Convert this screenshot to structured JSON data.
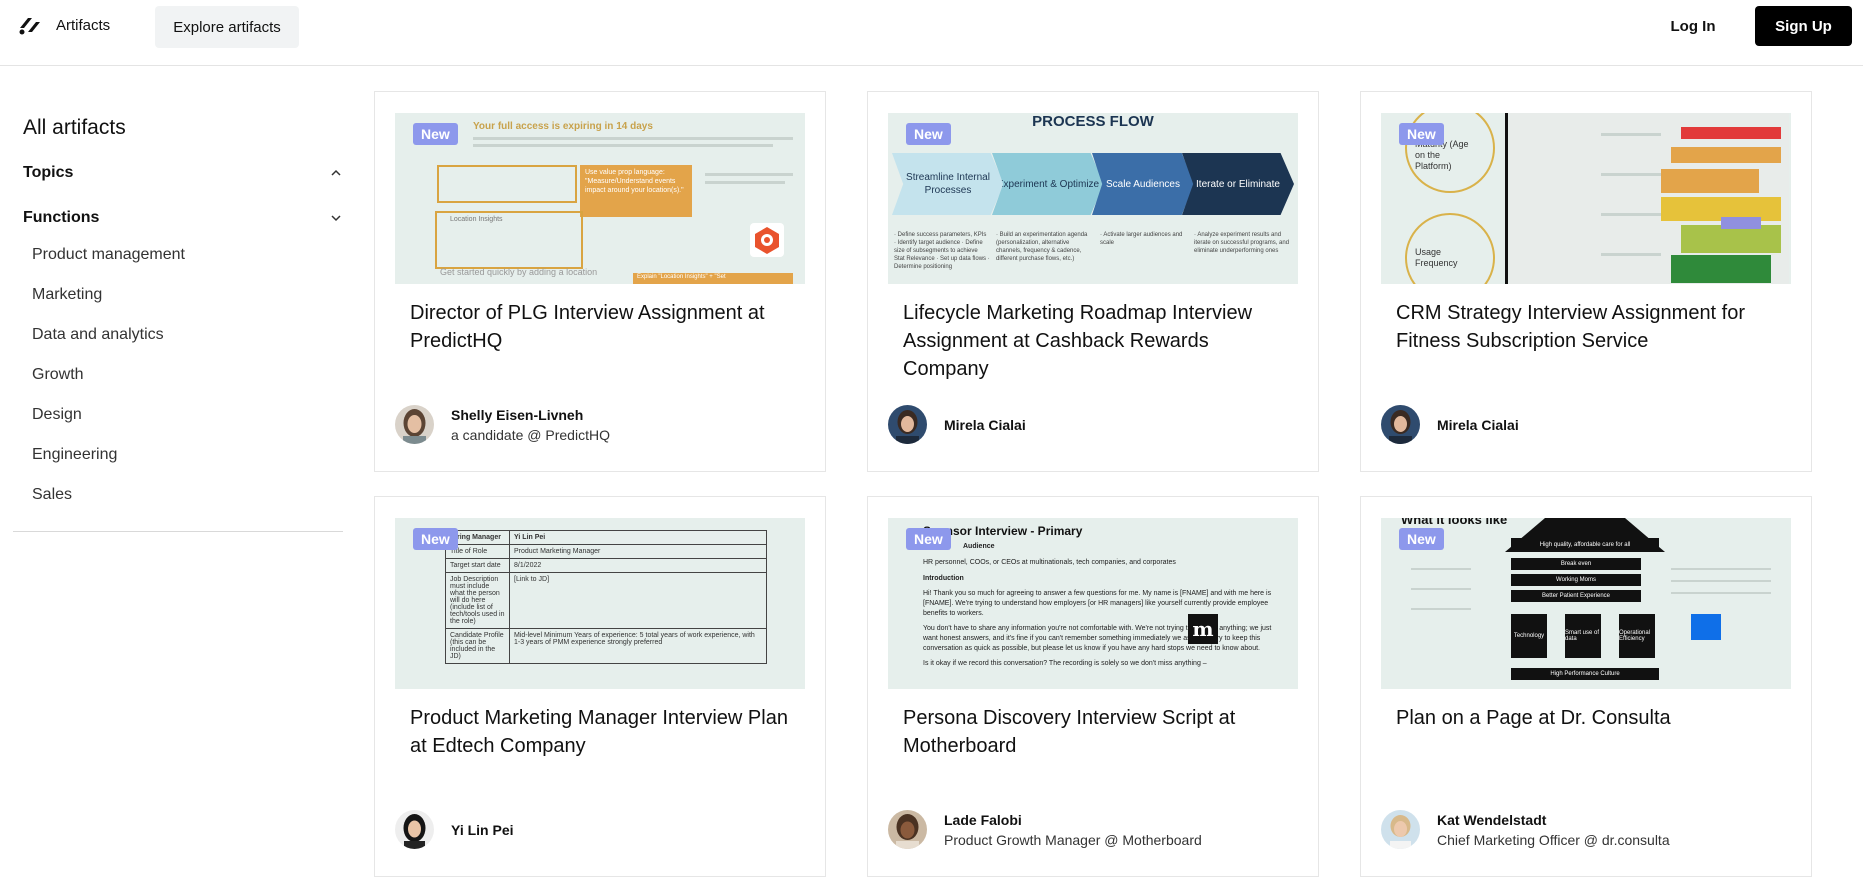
{
  "header": {
    "brand": "Artifacts",
    "explore": "Explore artifacts",
    "login": "Log In",
    "signup": "Sign Up"
  },
  "sidebar": {
    "title": "All artifacts",
    "topics": "Topics",
    "functions": "Functions",
    "function_items": [
      "Product management",
      "Marketing",
      "Data and analytics",
      "Growth",
      "Design",
      "Engineering",
      "Sales"
    ]
  },
  "cards": [
    {
      "badge": "New",
      "title": "Director of PLG Interview Assignment at PredictHQ",
      "author": "Shelly Eisen-Livneh",
      "role": "a candidate @ PredictHQ",
      "thumb": {
        "text1": "Your full access is expiring in 14 days",
        "text2": "Use value prop language: \"Measure/Understand events impact around your location(s).\"",
        "text3": "Location Insights",
        "text4": "Get started quickly by adding a location",
        "text5": "Explain \"Location Insights\" + \"Set"
      }
    },
    {
      "badge": "New",
      "title": "Lifecycle Marketing Roadmap Interview Assignment at Cashback Rewards Company",
      "author": "Mirela Cialai",
      "role": "",
      "thumb": {
        "heading": "PROCESS FLOW",
        "steps": [
          "Streamline Internal Processes",
          "Experiment & Optimize",
          "Scale Audiences",
          "Iterate or Eliminate"
        ],
        "cols": [
          "· Define success parameters, KPIs · Identify target audience · Define size of subsegments to achieve Stat Relevance · Set up data flows · Determine positioning",
          "· Build an experimentation agenda (personalization, alternative channels, frequency & cadence, different purchase flows, etc.)",
          "· Activate larger audiences and scale",
          "· Analyze experiment results and iterate on successful programs, and eliminate underperforming ones"
        ]
      }
    },
    {
      "badge": "New",
      "title": "CRM Strategy Interview Assignment for Fitness Subscription Service",
      "author": "Mirela Cialai",
      "role": "",
      "thumb": {
        "circle1": "Maturity (Age on the Platform)",
        "circle2": "Usage Frequency"
      }
    },
    {
      "badge": "New",
      "title": "Product Marketing Manager Interview Plan at Edtech Company",
      "author": "Yi Lin Pei",
      "role": "",
      "thumb": {
        "rows": [
          [
            "Hiring Manager",
            "Yi Lin Pei"
          ],
          [
            "Title of Role",
            "Product Marketing Manager"
          ],
          [
            "Target start date",
            "8/1/2022"
          ],
          [
            "Job Description must include what the person will do here (include list of tech/tools used in the role)",
            "[Link to JD]"
          ],
          [
            "Candidate Profile (this can be included in the JD)",
            "Mid-level Minimum Years of experience: 5 total years of work experience, with 1-3 years of PMM experience strongly preferred"
          ]
        ]
      }
    },
    {
      "badge": "New",
      "title": "Persona Discovery Interview Script at Motherboard",
      "author": "Lade Falobi",
      "role": "Product Growth Manager @ Motherboard",
      "thumb": {
        "heading": "Sponsor Interview - Primary",
        "audience": "Audience",
        "audience_text": "HR personnel, COOs, or CEOs at multinationals, tech companies, and corporates",
        "intro": "Introduction",
        "p1": "Hi! Thank you so much for agreeing to answer a few questions for me. My name is [FNAME] and with me here is [FNAME]. We're trying to understand how employers [or HR managers] like yourself currently provide employee benefits to workers.",
        "p2": "You don't have to share any information you're not comfortable with. We're not trying to sell you anything; we just want honest answers, and it's fine if you can't remember something immediately we ask. We'll try to keep this conversation as quick as possible, but please let us know if you have any hard stops we need to know about.",
        "p3": "Is it okay if we record this conversation? The recording is solely so we don't miss anything –",
        "logo": "m"
      }
    },
    {
      "badge": "New",
      "title": "Plan on a Page at Dr. Consulta",
      "author": "Kat Wendelstadt",
      "role": "Chief Marketing Officer @ dr.consulta",
      "thumb": {
        "heading": "What it looks like",
        "roof": "High quality, affordable care for all",
        "bars": [
          "Break even",
          "Working Moms",
          "Better Patient Experience"
        ],
        "pillars": [
          "Technology",
          "Smart use of data",
          "Operational Efficiency"
        ],
        "base": "High Performance Culture"
      }
    }
  ]
}
